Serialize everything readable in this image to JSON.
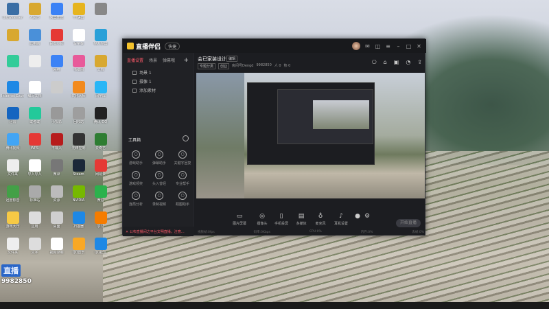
{
  "desktop": {
    "icons": [
      {
        "label": "UltraViewer",
        "color": "#3a6ea5"
      },
      {
        "label": "人民币",
        "color": "#d8a830"
      },
      {
        "label": "阿里旺旺",
        "color": "#3b82f6"
      },
      {
        "label": "YY语音",
        "color": "#e6b41e"
      },
      {
        "label": "",
        "color": "#888"
      },
      {
        "label": "",
        "color": "#d8a830"
      },
      {
        "label": "此电脑",
        "color": "#4a90d9"
      },
      {
        "label": "民有小师",
        "color": "#e53935"
      },
      {
        "label": "写字板",
        "color": "#fff"
      },
      {
        "label": "导入导出",
        "color": "#2aa0d8"
      },
      {
        "label": "",
        "color": "#3c9"
      },
      {
        "label": "",
        "color": "#eee"
      },
      {
        "label": "网络",
        "color": "#3b82f6"
      },
      {
        "label": "书稿图",
        "color": "#e85a9a"
      },
      {
        "label": "文档",
        "color": "#d8a830"
      },
      {
        "label": "Internet Explorer",
        "color": "#1e88e5"
      },
      {
        "label": "编写文档",
        "color": "#fff"
      },
      {
        "label": "",
        "color": "#ccc"
      },
      {
        "label": "优化大师",
        "color": "#f28a1e"
      },
      {
        "label": "闭字库",
        "color": "#29b6f6"
      },
      {
        "label": "迅雷",
        "color": "#1565c0"
      },
      {
        "label": "或者或",
        "color": "#23c99a"
      },
      {
        "label": "小投影",
        "color": "#999"
      },
      {
        "label": "回收站",
        "color": "#9e9e9e"
      },
      {
        "label": "腾讯 QQ",
        "color": "#222"
      },
      {
        "label": "腾讯视频",
        "color": "#42a5f5"
      },
      {
        "label": "WPS",
        "color": "#e53935"
      },
      {
        "label": "不输入",
        "color": "#b71c1c"
      },
      {
        "label": "无精控制",
        "color": "#333"
      },
      {
        "label": "爱奇艺",
        "color": "#2e7d32"
      },
      {
        "label": "文件来",
        "color": "#eee"
      },
      {
        "label": "导入导入",
        "color": "#fff"
      },
      {
        "label": "微录",
        "color": "#777"
      },
      {
        "label": "Steam",
        "color": "#1b2838"
      },
      {
        "label": "网易云",
        "color": "#e53935"
      },
      {
        "label": "迅雷影音",
        "color": "#43a047"
      },
      {
        "label": "标准站",
        "color": "#aaa"
      },
      {
        "label": "资源",
        "color": "#bbb"
      },
      {
        "label": "NVIDIA",
        "color": "#76b900"
      },
      {
        "label": "微信",
        "color": "#2bb24c"
      },
      {
        "label": "游戏大厅",
        "color": "#f6c945"
      },
      {
        "label": "应用",
        "color": "#ddd"
      },
      {
        "label": "桌面",
        "color": "#cfcfcf"
      },
      {
        "label": "扫描器",
        "color": "#1e88e5"
      },
      {
        "label": "学习",
        "color": "#f57c00"
      },
      {
        "label": "文件夹",
        "color": "#eee"
      },
      {
        "label": "文字",
        "color": "#ddd"
      },
      {
        "label": "视频录制",
        "color": "#fff"
      },
      {
        "label": "QQ音乐",
        "color": "#f9a825"
      },
      {
        "label": "QQ社区",
        "color": "#1e88e5"
      }
    ],
    "brand_logo": "直播",
    "brand_number": "9982850"
  },
  "app": {
    "title": "直播伴侣",
    "version": "快捷",
    "left_tabs": [
      "直播设置",
      "场景",
      "弹幕哦"
    ],
    "scenes": [
      "场景 1",
      "摄像 1",
      "添加素材"
    ],
    "tools_header": "工具箱",
    "tools": [
      "游戏助手",
      "弹幕助手",
      "关键字回复",
      "游戏领奖",
      "头入曾经",
      "专业帮手",
      "连局分析",
      "录制视频",
      "截图助手"
    ],
    "status_text": "✕ 公布直播间之平台文明直播，注意…",
    "room_title": "会已家装设计",
    "room_edit": "编辑",
    "room_info": [
      "专题分类",
      "创业",
      "房间号Dengd",
      "9982850",
      "人 0",
      "热 0"
    ],
    "controls": [
      "图片屏幕",
      "摄像头",
      "手机投屏",
      "多媒体",
      "麦克风",
      "耳机设置"
    ],
    "golive": "开始直播",
    "stats": [
      "视频帧:0fps",
      "码率:0Kbps",
      "CPU:0%",
      "内存:0%",
      "丢帧:0%"
    ]
  }
}
